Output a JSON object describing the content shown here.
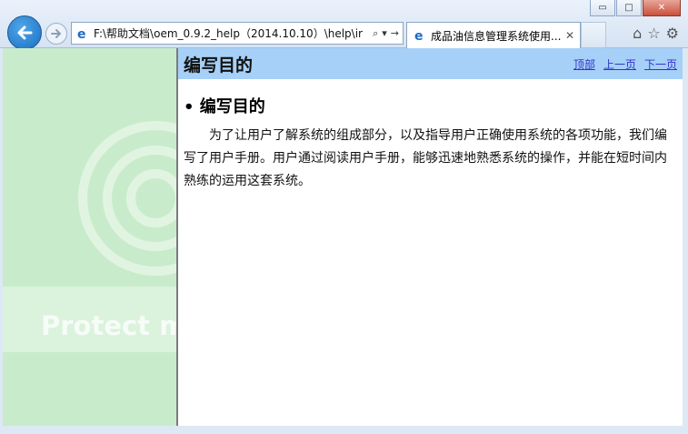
{
  "window": {
    "minimize_glyph": "▭",
    "maximize_glyph": "□",
    "close_glyph": "✕"
  },
  "toolbar": {
    "address": "F:\\帮助文档\\oem_0.9.2_help（2014.10.10）\\help\\ir",
    "search_glyph": "⌕",
    "dropdown_glyph": "▾",
    "go_glyph": "→"
  },
  "tab": {
    "title": "成品油信息管理系统使用...",
    "close_glyph": "✕"
  },
  "tools": {
    "home_glyph": "⌂",
    "favorites_glyph": "☆",
    "settings_glyph": "⚙"
  },
  "sidebar": {
    "watermark": "Protect m"
  },
  "page": {
    "header_title": "编写目的",
    "nav_top": "顶部",
    "nav_prev": "上一页",
    "nav_next": "下一页",
    "section_title": "• 编写目的",
    "paragraph": "为了让用户了解系统的组成部分，以及指导用户正确使用系统的各项功能，我们编写了用户手册。用户通过阅读用户手册，能够迅速地熟悉系统的操作，并能在短时间内熟练的运用这套系统。"
  },
  "colors": {
    "header_bg": "#a6d0f7",
    "sidebar_bg": "#c8eccb",
    "link": "#3333cc"
  }
}
